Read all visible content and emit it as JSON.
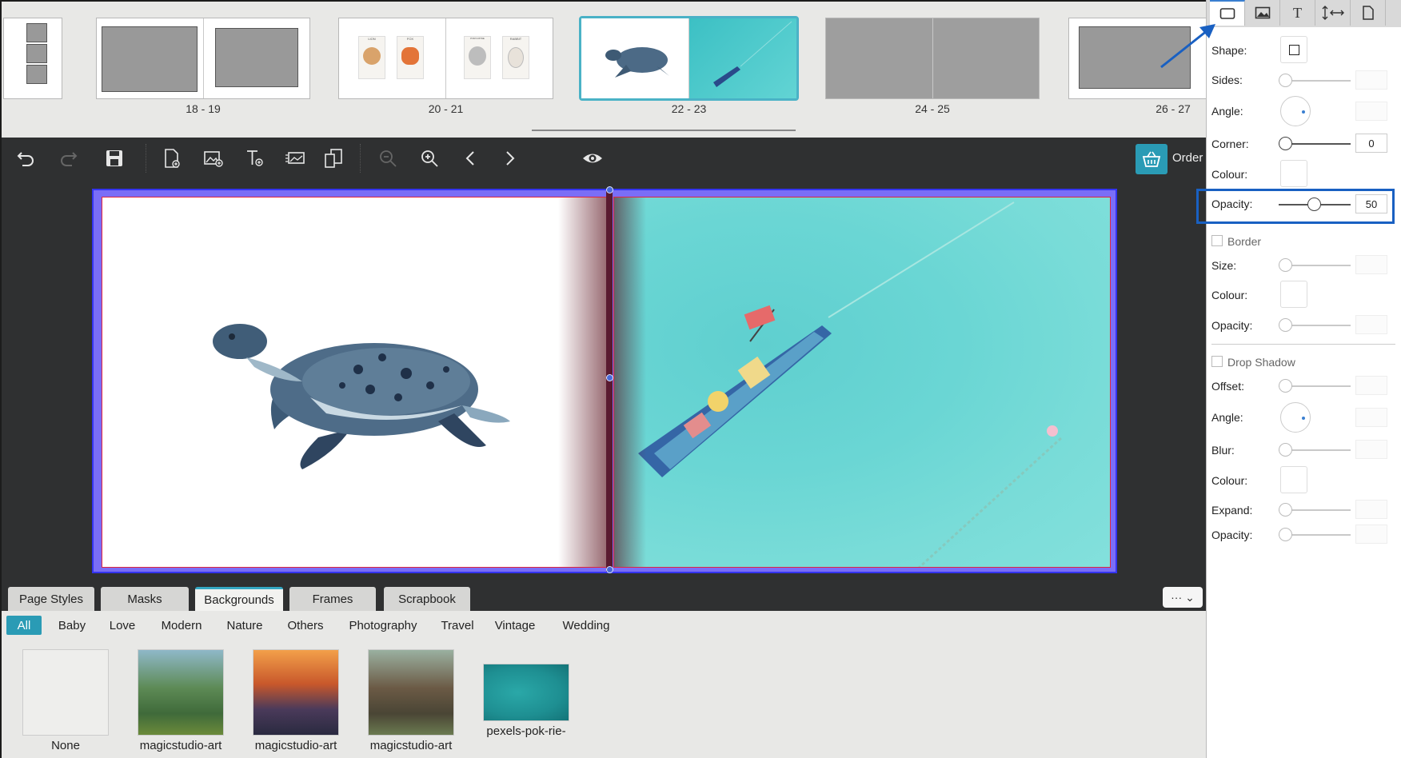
{
  "spreads": [
    {
      "label": "",
      "kind": "single-strip"
    },
    {
      "label": "18 - 19"
    },
    {
      "label": "20 - 21",
      "cards": [
        "LION",
        "FOX",
        "PORCUPINE",
        "RABBIT"
      ]
    },
    {
      "label": "22 - 23",
      "selected": true
    },
    {
      "label": "24 - 25"
    },
    {
      "label": "26 - 27"
    }
  ],
  "toolbar": {
    "undo_icon": "undo-icon",
    "redo_icon": "redo-icon",
    "save_icon": "save-icon",
    "order_label": "Order"
  },
  "library": {
    "tabs": [
      "Page Styles",
      "Masks",
      "Backgrounds",
      "Frames",
      "Scrapbook"
    ],
    "active_tab": "Backgrounds",
    "more_label": "···",
    "categories": [
      "All",
      "Baby",
      "Love",
      "Modern",
      "Nature",
      "Others",
      "Photography",
      "Travel",
      "Vintage",
      "Wedding"
    ],
    "active_category": "All",
    "items": [
      {
        "label": "None"
      },
      {
        "label": "magicstudio-art"
      },
      {
        "label": "magicstudio-art"
      },
      {
        "label": "magicstudio-art"
      },
      {
        "label": "pexels-pok-rie-"
      }
    ]
  },
  "panel": {
    "shape_label": "Shape:",
    "sides_label": "Sides:",
    "angle_label": "Angle:",
    "corner_label": "Corner:",
    "corner_value": "0",
    "colour_label": "Colour:",
    "opacity_label": "Opacity:",
    "opacity_value": "50",
    "border_label": "Border",
    "size_label": "Size:",
    "border_colour_label": "Colour:",
    "border_opacity_label": "Opacity:",
    "drop_shadow_label": "Drop Shadow",
    "offset_label": "Offset:",
    "shadow_angle_label": "Angle:",
    "blur_label": "Blur:",
    "shadow_colour_label": "Colour:",
    "expand_label": "Expand:",
    "shadow_opacity_label": "Opacity:"
  },
  "colors": {
    "accent": "#2a9bb5",
    "highlight": "#1960c2",
    "page_border": "#e0263f"
  }
}
